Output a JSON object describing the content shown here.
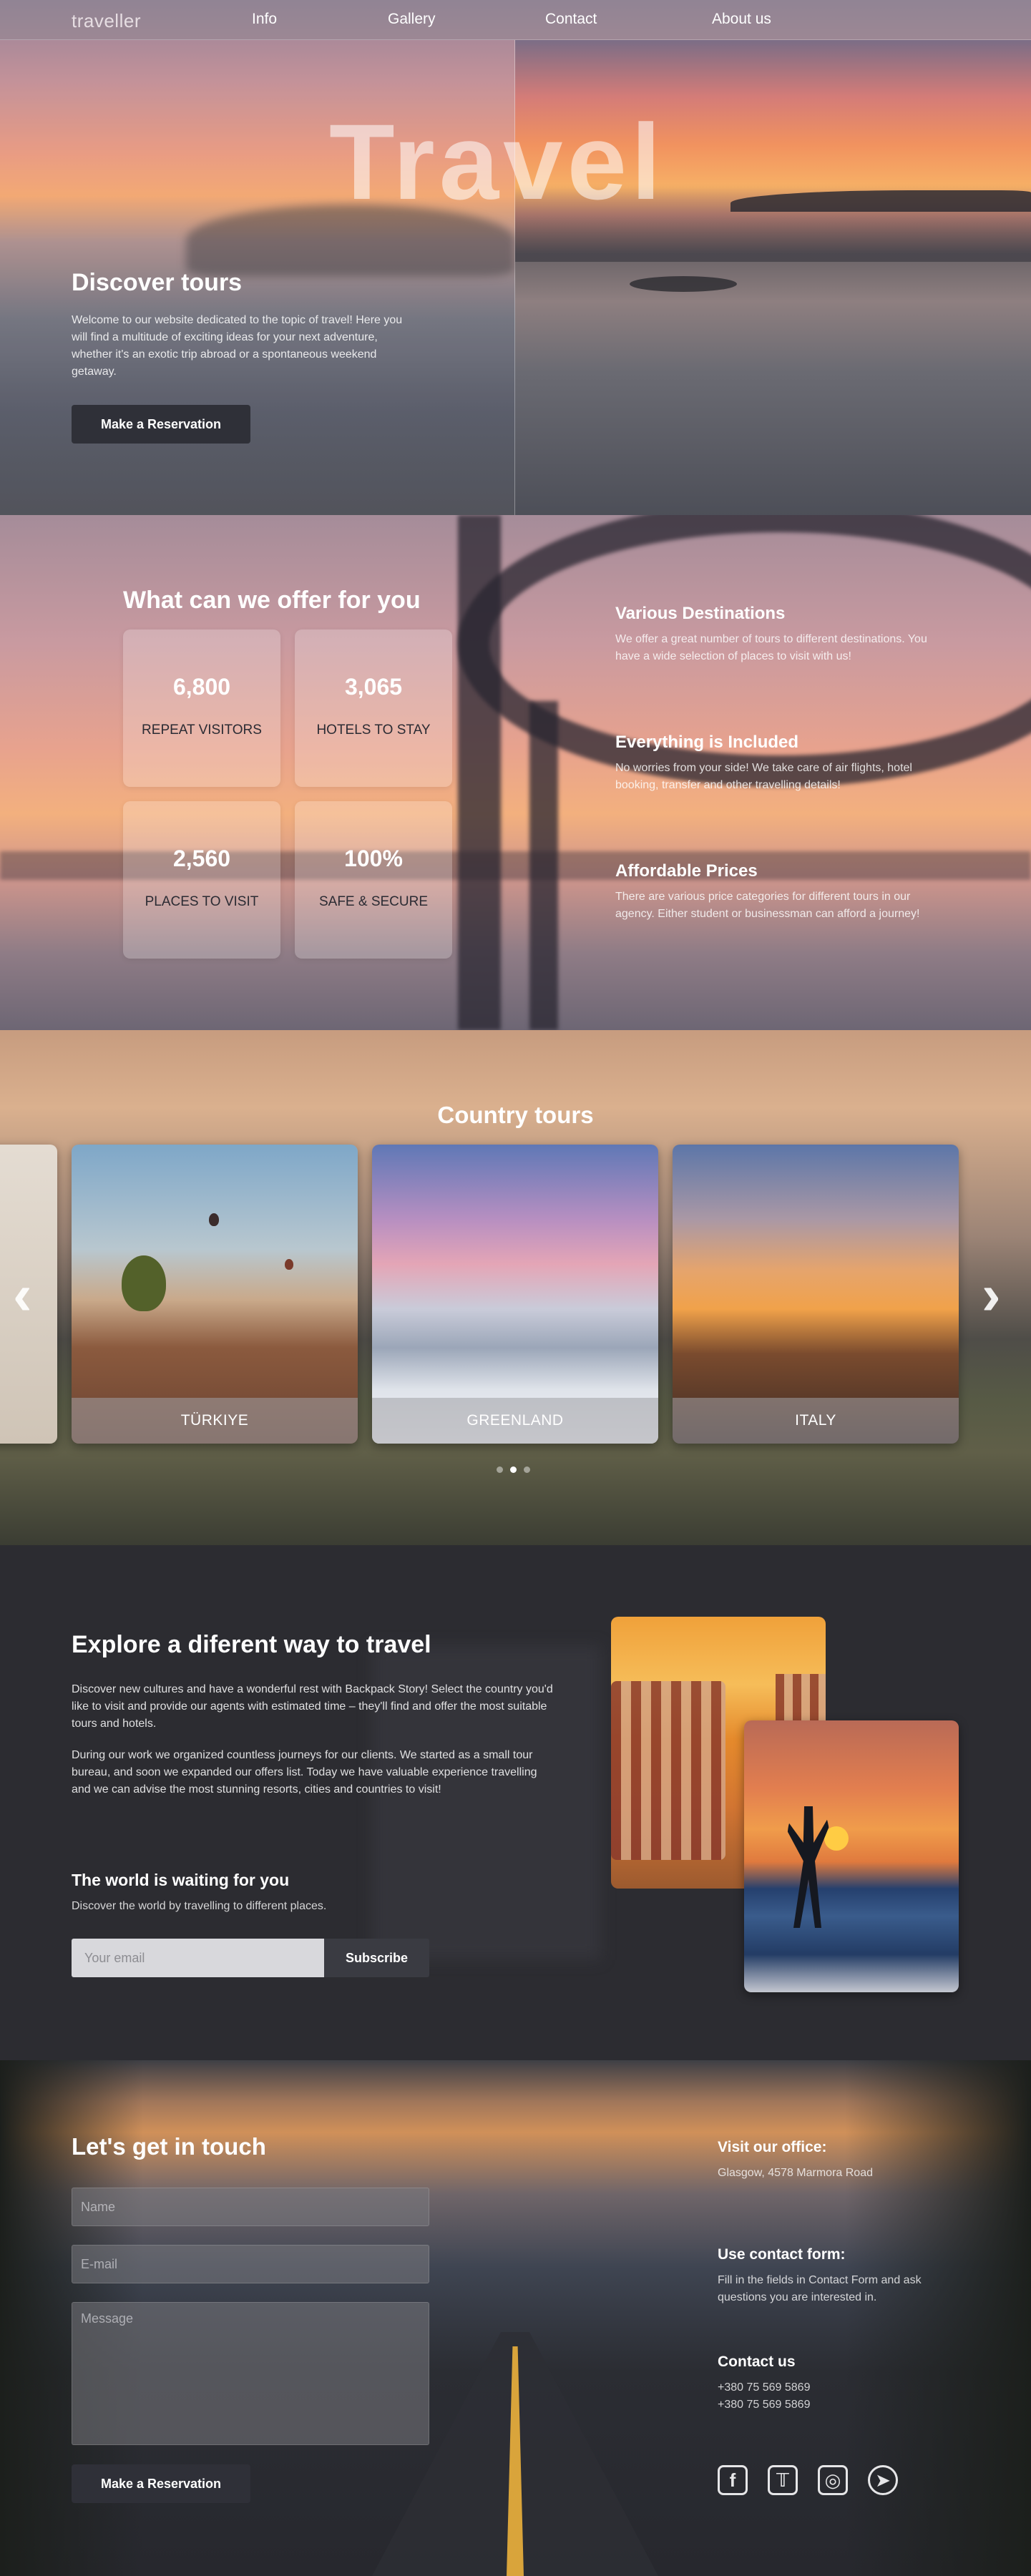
{
  "nav": {
    "logo": "traveller",
    "links": [
      "Info",
      "Gallery",
      "Contact",
      "About us"
    ]
  },
  "hero": {
    "big_title": "Travel",
    "heading": "Discover tours",
    "text": "Welcome to our website dedicated to the topic of travel! Here you will find a multitude of exciting ideas for your next adventure, whether it's an exotic trip abroad or a spontaneous weekend getaway.",
    "button": "Make a Reservation"
  },
  "offer": {
    "heading": "What can we offer for you",
    "stats": [
      {
        "value": "6,800",
        "label": "REPEAT VISITORS"
      },
      {
        "value": "3,065",
        "label": "HOTELS TO STAY"
      },
      {
        "value": "2,560",
        "label": "PLACES TO VISIT"
      },
      {
        "value": "100%",
        "label": "SAFE & SECURE"
      }
    ],
    "features": [
      {
        "title": "Various Destinations",
        "text": "We offer a great number of tours to different destinations. You have a wide selection of places to visit with us!"
      },
      {
        "title": "Everything is Included",
        "text": "No worries from your side! We take care of air flights, hotel booking, transfer and other travelling details!"
      },
      {
        "title": "Affordable Prices",
        "text": "There are various price categories for different tours in our agency. Either student or businessman can afford a journey!"
      }
    ]
  },
  "tours": {
    "heading": "Country tours",
    "cards": [
      "TÜRKIYE",
      "GREENLAND",
      "ITALY"
    ],
    "prev_icon": "chevron-left-icon",
    "next_icon": "chevron-right-icon",
    "active_dot": 1
  },
  "explore": {
    "heading": "Explore a diferent way to travel",
    "para1": "Discover new cultures and have a wonderful rest with Backpack Story! Select the country you'd like to visit and provide our agents with estimated time – they'll find and offer the most suitable tours and hotels.",
    "para2": "During our work we organized countless journeys for our clients. We started as a small tour bureau, and soon we expanded our offers list. Today we have valuable experience travelling and we can advise the most stunning resorts, cities and countries to visit!",
    "sub_heading": "The world is waiting for you",
    "sub_text": "Discover the world by travelling to different places.",
    "email_placeholder": "Your email",
    "subscribe": "Subscribe"
  },
  "contact": {
    "heading": "Let's get in touch",
    "name_placeholder": "Name",
    "email_placeholder": "E-mail",
    "message_placeholder": "Message",
    "button": "Make a Reservation",
    "office_title": "Visit our office:",
    "office_address": "Glasgow, 4578 Marmora Road",
    "form_title": "Use contact form:",
    "form_text": "Fill in the fields in Contact Form and ask questions you are interested in.",
    "contact_title": "Contact us",
    "phones": [
      "+380 75 569 5869",
      "+380 75 569 5869"
    ],
    "social": [
      "facebook-icon",
      "twitter-icon",
      "instagram-icon",
      "telegram-icon"
    ]
  }
}
